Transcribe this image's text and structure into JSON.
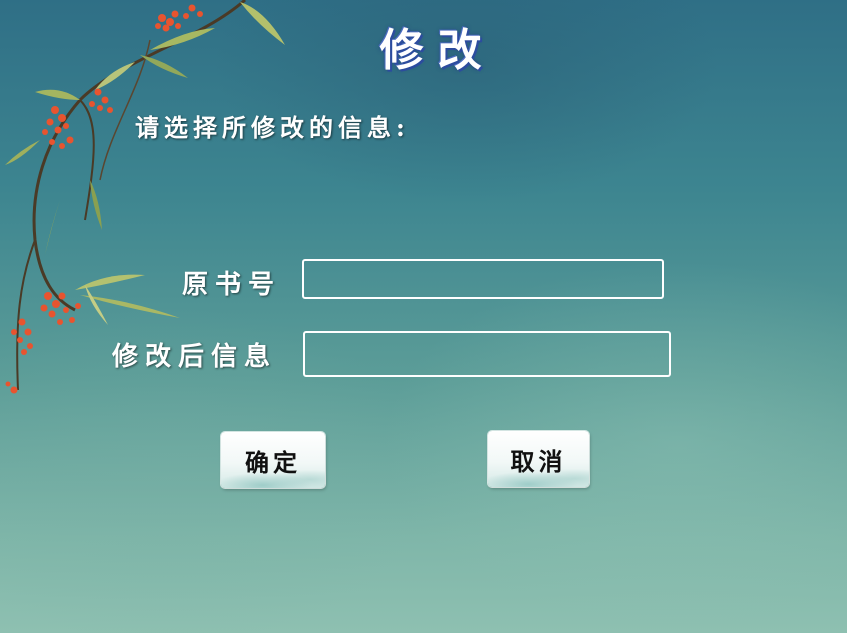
{
  "form": {
    "title": "修改",
    "prompt": "请选择所修改的信息:",
    "old_book_number_label": "原书号",
    "old_book_number_value": "",
    "new_info_label": "修改后信息",
    "new_info_value": ""
  },
  "buttons": {
    "confirm_label": "确定",
    "cancel_label": "取消"
  },
  "decoration": {
    "illustration": "bamboo-branch-with-red-berries",
    "accent_color": "#e8542f",
    "leaf_color": "#9cb35a",
    "background_top": "#2f6f86",
    "background_bottom": "#8ec0b1"
  }
}
